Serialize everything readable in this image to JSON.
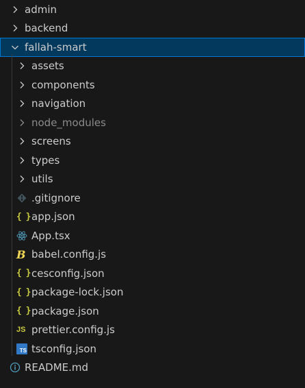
{
  "explorer": {
    "root_items": [
      {
        "label": "admin",
        "type": "folder",
        "expanded": false
      },
      {
        "label": "backend",
        "type": "folder",
        "expanded": false
      },
      {
        "label": "fallah-smart",
        "type": "folder",
        "expanded": true,
        "selected": true
      }
    ],
    "children": [
      {
        "label": "assets",
        "type": "folder"
      },
      {
        "label": "components",
        "type": "folder"
      },
      {
        "label": "navigation",
        "type": "folder"
      },
      {
        "label": "node_modules",
        "type": "folder",
        "dimmed": true
      },
      {
        "label": "screens",
        "type": "folder"
      },
      {
        "label": "types",
        "type": "folder"
      },
      {
        "label": "utils",
        "type": "folder"
      },
      {
        "label": ".gitignore",
        "type": "file",
        "icon": "git-icon"
      },
      {
        "label": "app.json",
        "type": "file",
        "icon": "json-icon"
      },
      {
        "label": "App.tsx",
        "type": "file",
        "icon": "react-icon"
      },
      {
        "label": "babel.config.js",
        "type": "file",
        "icon": "babel-icon"
      },
      {
        "label": "cesconfig.json",
        "type": "file",
        "icon": "json-icon"
      },
      {
        "label": "package-lock.json",
        "type": "file",
        "icon": "json-icon"
      },
      {
        "label": "package.json",
        "type": "file",
        "icon": "json-icon"
      },
      {
        "label": "prettier.config.js",
        "type": "file",
        "icon": "js-icon"
      },
      {
        "label": "tsconfig.json",
        "type": "file",
        "icon": "typescript-icon"
      }
    ],
    "trailing_items": [
      {
        "label": "README.md",
        "type": "file",
        "icon": "info-icon"
      }
    ],
    "icon_text": {
      "braces": "{ }",
      "js": "JS",
      "ts": "TS",
      "babel": "B"
    },
    "colors": {
      "background": "#181818",
      "selected_background": "#04395e",
      "selected_border": "#0078d4",
      "text": "#cccccc",
      "dimmed_text": "#8b8b8b",
      "json_icon": "#cbcb41",
      "react_icon": "#519aba",
      "typescript_icon": "#3178c6",
      "info_icon": "#519aba"
    }
  }
}
